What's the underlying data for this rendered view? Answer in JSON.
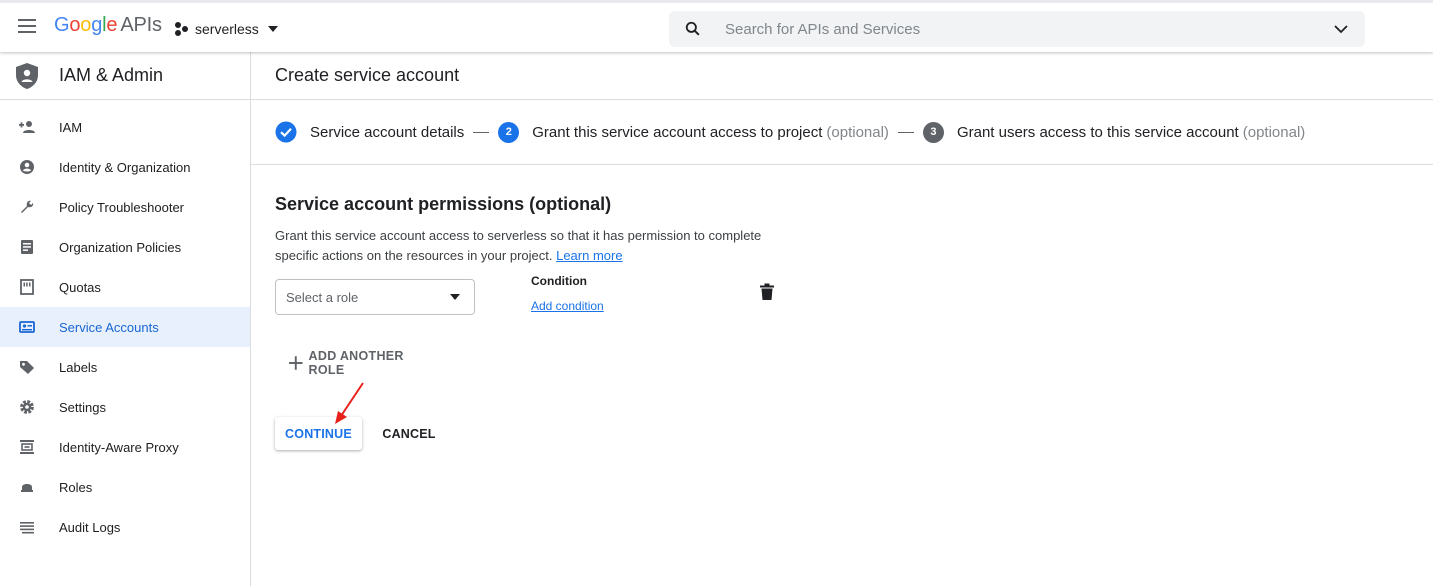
{
  "header": {
    "logo_text": "Google",
    "logo_suffix": "APIs",
    "project_name": "serverless",
    "search_placeholder": "Search for APIs and Services"
  },
  "sidebar": {
    "title": "IAM & Admin",
    "items": [
      {
        "label": "IAM",
        "icon": "person-add-icon"
      },
      {
        "label": "Identity & Organization",
        "icon": "account-circle-icon"
      },
      {
        "label": "Policy Troubleshooter",
        "icon": "wrench-icon"
      },
      {
        "label": "Organization Policies",
        "icon": "document-icon"
      },
      {
        "label": "Quotas",
        "icon": "quota-icon"
      },
      {
        "label": "Service Accounts",
        "icon": "service-account-icon",
        "active": true
      },
      {
        "label": "Labels",
        "icon": "tag-icon"
      },
      {
        "label": "Settings",
        "icon": "gear-icon"
      },
      {
        "label": "Identity-Aware Proxy",
        "icon": "proxy-icon"
      },
      {
        "label": "Roles",
        "icon": "roles-icon"
      },
      {
        "label": "Audit Logs",
        "icon": "list-icon"
      }
    ]
  },
  "main": {
    "title": "Create service account",
    "steps": [
      {
        "label": "Service account details",
        "state": "done"
      },
      {
        "number": "2",
        "label": "Grant this service account access to project",
        "optional": "(optional)",
        "state": "active"
      },
      {
        "number": "3",
        "label": "Grant users access to this service account",
        "optional": "(optional)",
        "state": "pending"
      }
    ],
    "section_title": "Service account permissions (optional)",
    "description": "Grant this service account access to serverless so that it has permission to complete specific actions on the resources in your project.",
    "learn_more": "Learn more",
    "role_placeholder": "Select a role",
    "condition_label": "Condition",
    "add_condition": "Add condition",
    "add_another_role": "ADD ANOTHER ROLE",
    "continue_label": "CONTINUE",
    "cancel_label": "CANCEL"
  },
  "colors": {
    "accent": "#1a73e8",
    "active_bg": "#e8f0fe",
    "annotation_arrow": "#e8211a"
  }
}
